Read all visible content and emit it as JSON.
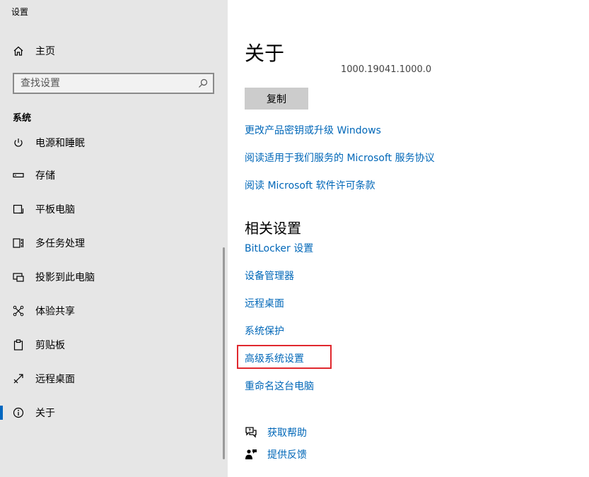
{
  "window": {
    "title": "设置"
  },
  "sidebar": {
    "home_label": "主页",
    "search_placeholder": "查找设置",
    "section_title": "系统",
    "items": [
      {
        "label": "电源和睡眠",
        "icon": "power-icon"
      },
      {
        "label": "存储",
        "icon": "storage-icon"
      },
      {
        "label": "平板电脑",
        "icon": "tablet-icon"
      },
      {
        "label": "多任务处理",
        "icon": "multitasking-icon"
      },
      {
        "label": "投影到此电脑",
        "icon": "project-icon"
      },
      {
        "label": "体验共享",
        "icon": "shared-experiences-icon"
      },
      {
        "label": "剪贴板",
        "icon": "clipboard-icon"
      },
      {
        "label": "远程桌面",
        "icon": "remote-desktop-icon"
      },
      {
        "label": "关于",
        "icon": "info-icon",
        "selected": true
      }
    ]
  },
  "main": {
    "title": "关于",
    "version_text": "1000.19041.1000.0",
    "copy_button": "复制",
    "links": [
      "更改产品密钥或升级 Windows",
      "阅读适用于我们服务的 Microsoft 服务协议",
      "阅读 Microsoft 软件许可条款"
    ],
    "related_title": "相关设置",
    "related_links": [
      "BitLocker 设置",
      "设备管理器",
      "远程桌面",
      "系统保护",
      "高级系统设置",
      "重命名这台电脑"
    ],
    "help": [
      {
        "label": "获取帮助",
        "icon": "help-chat-icon"
      },
      {
        "label": "提供反馈",
        "icon": "feedback-icon"
      }
    ]
  },
  "colors": {
    "accent": "#0067c0",
    "link": "#0067b8",
    "highlight_border": "#e0282e",
    "sidebar_bg": "#e6e6e6"
  }
}
